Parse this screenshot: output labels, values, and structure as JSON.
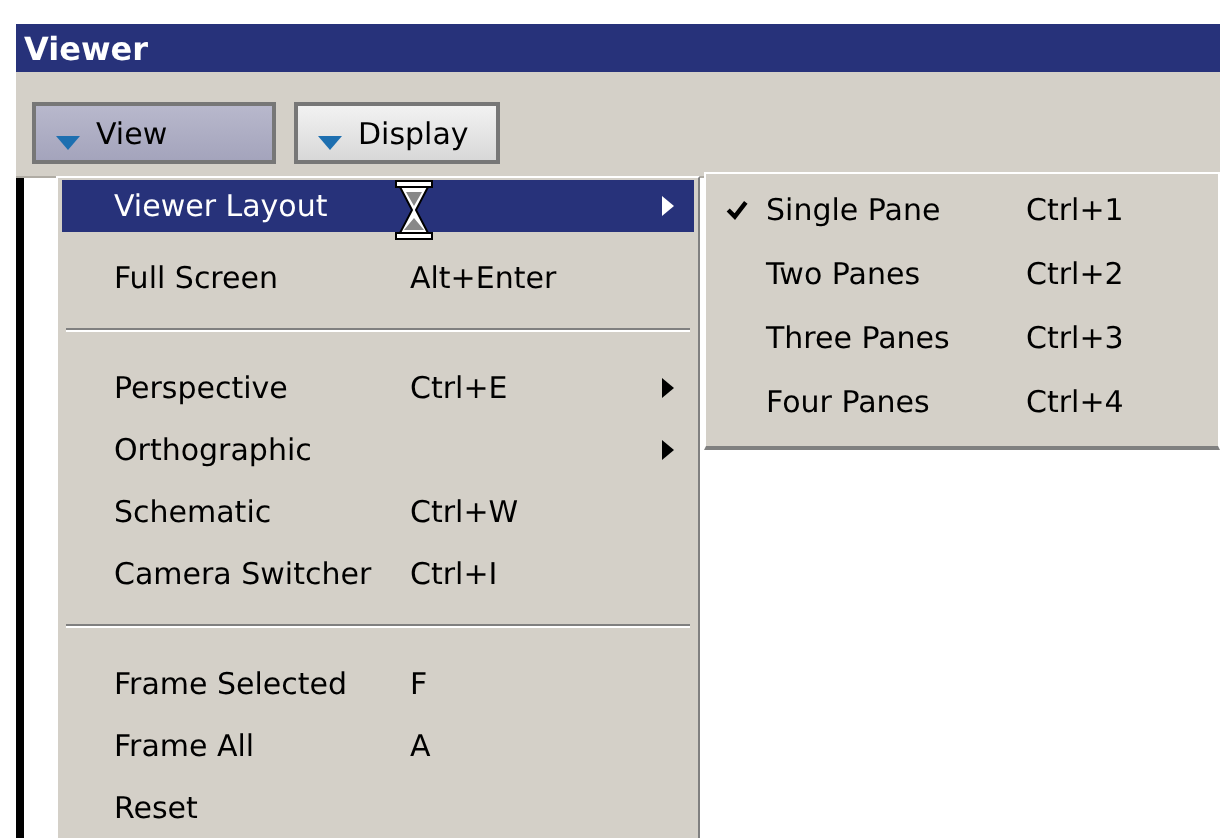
{
  "window": {
    "title": "Viewer"
  },
  "toolbar": [
    {
      "label": "View",
      "selected": true
    },
    {
      "label": "Display",
      "selected": false
    }
  ],
  "menu": [
    {
      "kind": "item",
      "label": "Viewer Layout",
      "submenu": true,
      "selected": true
    },
    {
      "kind": "item",
      "label": "Full Screen",
      "shortcut": "Alt+Enter",
      "submenu": false,
      "selected": false
    },
    {
      "kind": "separator"
    },
    {
      "kind": "item",
      "label": "Perspective",
      "shortcut": "Ctrl+E",
      "submenu": true,
      "selected": false
    },
    {
      "kind": "item",
      "label": "Orthographic",
      "submenu": true,
      "selected": false
    },
    {
      "kind": "item",
      "label": "Schematic",
      "shortcut": "Ctrl+W",
      "submenu": false,
      "selected": false
    },
    {
      "kind": "item",
      "label": "Camera Switcher",
      "shortcut": "Ctrl+I",
      "submenu": false,
      "selected": false
    },
    {
      "kind": "separator"
    },
    {
      "kind": "item",
      "label": "Frame Selected",
      "shortcut": "F",
      "submenu": false,
      "selected": false
    },
    {
      "kind": "item",
      "label": "Frame All",
      "shortcut": "A",
      "submenu": false,
      "selected": false
    },
    {
      "kind": "item",
      "label": "Reset",
      "submenu": false,
      "selected": false
    }
  ],
  "submenu": [
    {
      "label": "Single Pane",
      "shortcut": "Ctrl+1",
      "checked": true
    },
    {
      "label": "Two Panes",
      "shortcut": "Ctrl+2",
      "checked": false
    },
    {
      "label": "Three Panes",
      "shortcut": "Ctrl+3",
      "checked": false
    },
    {
      "label": "Four Panes",
      "shortcut": "Ctrl+4",
      "checked": false
    }
  ]
}
